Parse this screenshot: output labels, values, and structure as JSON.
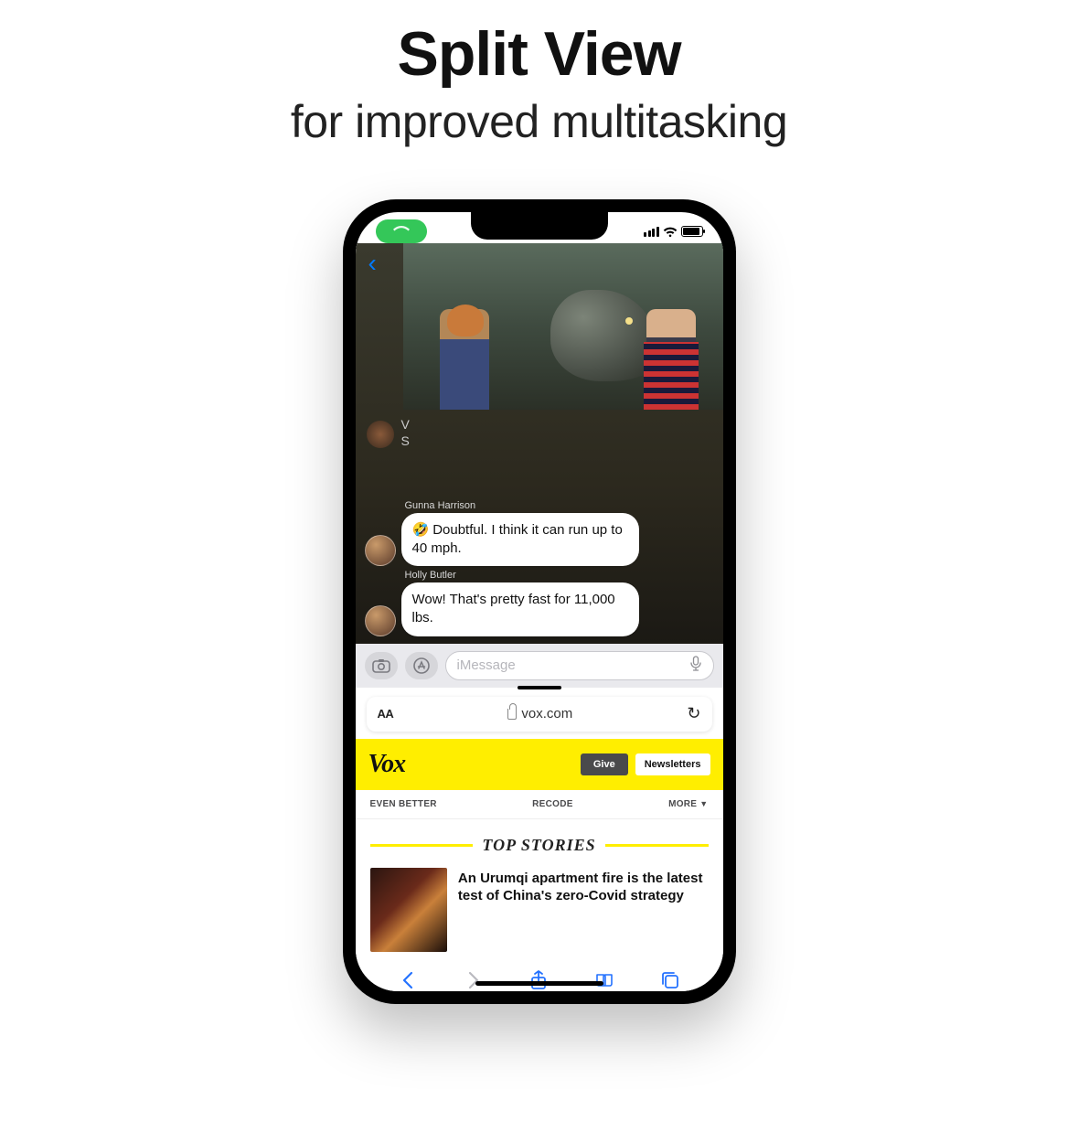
{
  "hero": {
    "title": "Split View",
    "subtitle": "for improved multitasking"
  },
  "statusBar": {
    "callActive": true
  },
  "messages": {
    "inputPlaceholder": "iMessage",
    "typingIndicator": {
      "line1": "V",
      "line2": "S"
    },
    "thread": [
      {
        "sender": "Gunna Harrison",
        "text": "Doubtful. I think it can run up to 40 mph.",
        "emoji": "🤣"
      },
      {
        "sender": "Holly Butler",
        "text": "Wow! That's pretty fast for 11,000 lbs."
      }
    ]
  },
  "safari": {
    "aa": "AA",
    "url": "vox.com",
    "vox": {
      "logo": "Vox",
      "giveLabel": "Give",
      "newsletterLabel": "Newsletters",
      "nav": [
        "EVEN BETTER",
        "RECODE",
        "MORE"
      ],
      "topStoriesLabel": "TOP STORIES",
      "story1": "An Urumqi apartment fire is the latest test of China's zero-Covid strategy"
    }
  }
}
